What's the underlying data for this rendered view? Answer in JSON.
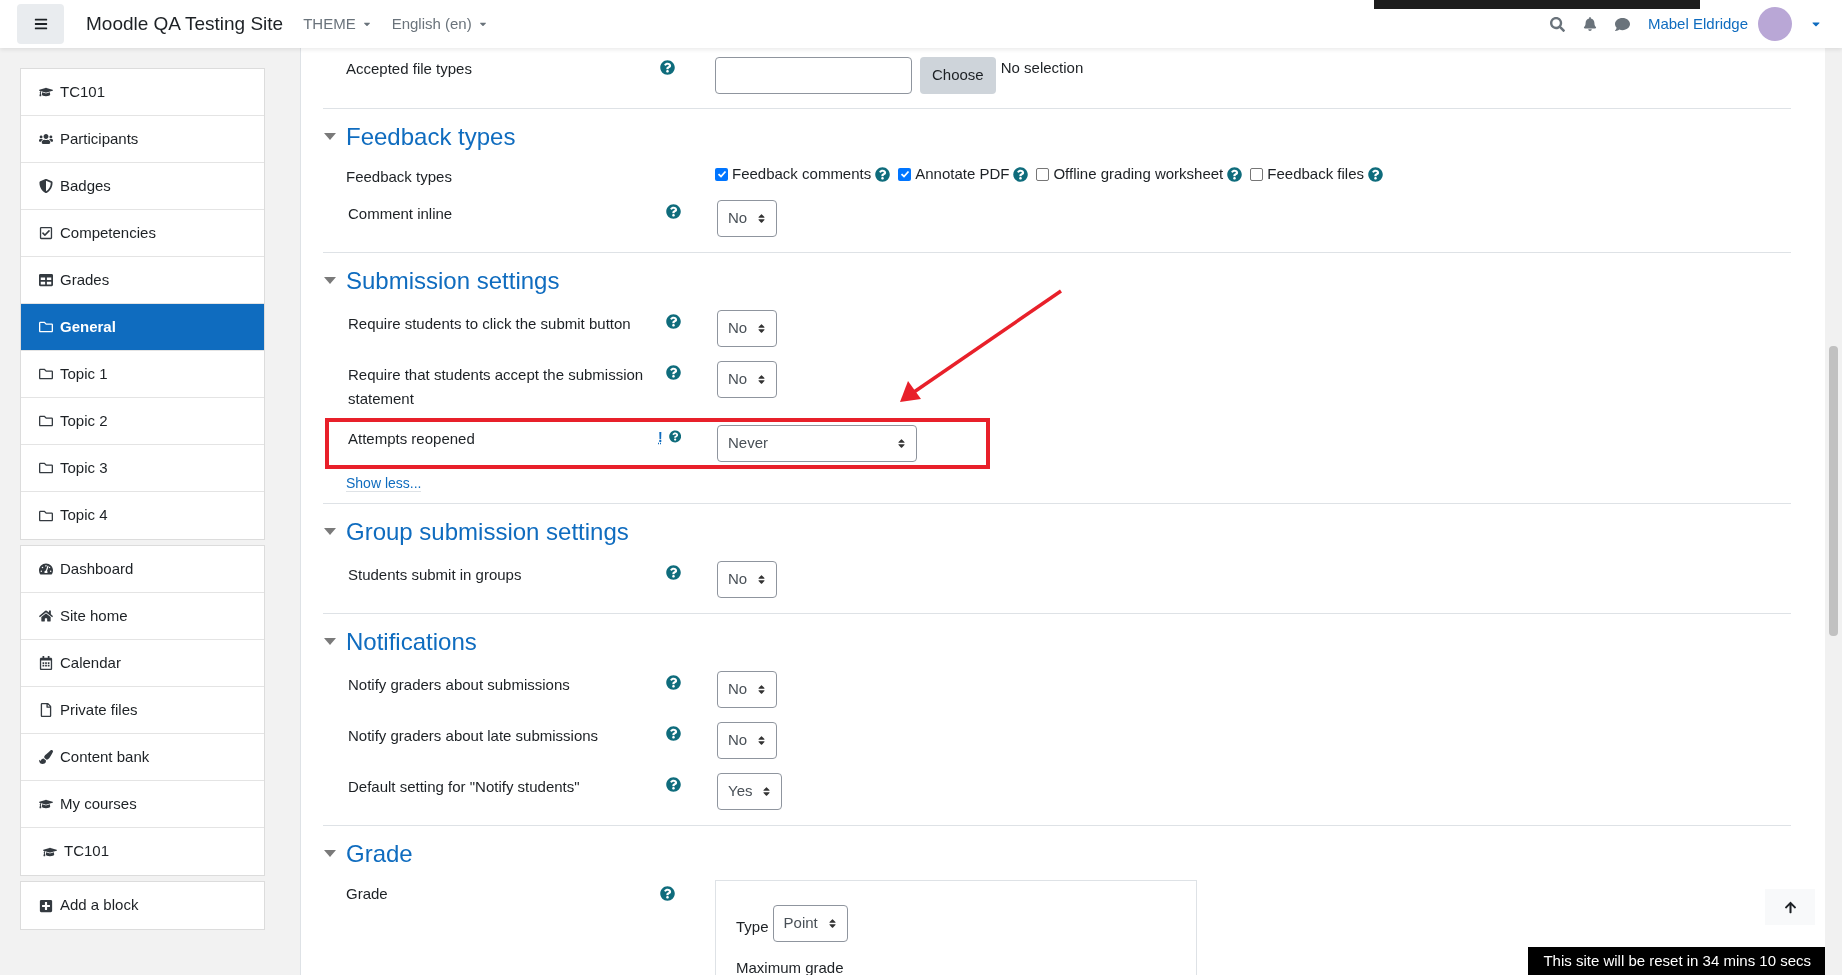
{
  "topbar": {
    "site_name": "Moodle QA Testing Site",
    "menus": [
      "THEME",
      "English (en)"
    ],
    "user_name": "Mabel Eldridge"
  },
  "sidebar": {
    "groups": [
      [
        {
          "label": "TC101",
          "kind": "course",
          "selected": false
        },
        {
          "label": "Participants",
          "kind": "people",
          "selected": false
        },
        {
          "label": "Badges",
          "kind": "badge",
          "selected": false
        },
        {
          "label": "Competencies",
          "kind": "check",
          "selected": false
        },
        {
          "label": "Grades",
          "kind": "table",
          "selected": false
        },
        {
          "label": "General",
          "kind": "folder",
          "selected": true
        },
        {
          "label": "Topic 1",
          "kind": "folder",
          "selected": false
        },
        {
          "label": "Topic 2",
          "kind": "folder",
          "selected": false
        },
        {
          "label": "Topic 3",
          "kind": "folder",
          "selected": false
        },
        {
          "label": "Topic 4",
          "kind": "folder",
          "selected": false
        }
      ],
      [
        {
          "label": "Dashboard",
          "kind": "dashboard",
          "selected": false
        },
        {
          "label": "Site home",
          "kind": "home",
          "selected": false
        },
        {
          "label": "Calendar",
          "kind": "calendar",
          "selected": false
        },
        {
          "label": "Private files",
          "kind": "file",
          "selected": false
        },
        {
          "label": "Content bank",
          "kind": "brush",
          "selected": false
        },
        {
          "label": "My courses",
          "kind": "course",
          "selected": false
        },
        {
          "label": "TC101",
          "kind": "subcourse",
          "selected": false
        }
      ],
      [
        {
          "label": "Add a block",
          "kind": "add",
          "selected": false
        }
      ]
    ]
  },
  "file_row": {
    "label": "Accepted file types",
    "button": "Choose",
    "status": "No selection"
  },
  "sections": [
    {
      "title": "Feedback types",
      "expanded": true,
      "rows": [
        {
          "kind": "checkboxes",
          "label": "Feedback types",
          "options": [
            {
              "label": "Feedback comments",
              "checked": true
            },
            {
              "label": "Annotate PDF",
              "checked": true
            },
            {
              "label": "Offline grading worksheet",
              "checked": false
            },
            {
              "label": "Feedback files",
              "checked": false
            }
          ]
        },
        {
          "kind": "select",
          "label": "Comment inline",
          "value": "No",
          "highlighted": false
        }
      ]
    },
    {
      "title": "Submission settings",
      "expanded": true,
      "rows": [
        {
          "kind": "select",
          "label": "Require students to click the submit button",
          "value": "No",
          "highlighted": false
        },
        {
          "kind": "select",
          "label": "Require that students accept the submission statement",
          "value": "No",
          "highlighted": false
        },
        {
          "kind": "select",
          "label": "Attempts reopened",
          "value": "Never",
          "highlighted": true,
          "flag": "!"
        }
      ],
      "link": "Show less..."
    },
    {
      "title": "Group submission settings",
      "expanded": true,
      "rows": [
        {
          "kind": "select",
          "label": "Students submit in groups",
          "value": "No",
          "highlighted": false
        }
      ]
    },
    {
      "title": "Notifications",
      "expanded": true,
      "rows": [
        {
          "kind": "select",
          "label": "Notify graders about submissions",
          "value": "No",
          "highlighted": false
        },
        {
          "kind": "select",
          "label": "Notify graders about late submissions",
          "value": "No",
          "highlighted": false
        },
        {
          "kind": "select",
          "label": "Default setting for \"Notify students\"",
          "value": "Yes",
          "highlighted": false
        }
      ]
    },
    {
      "title": "Grade",
      "expanded": true,
      "rows": [
        {
          "kind": "grade",
          "label": "Grade",
          "type_label": "Type",
          "type_value": "Point",
          "max_label": "Maximum grade"
        }
      ]
    }
  ],
  "reset_notice": "This site will be reset in 34 mins 10 secs"
}
